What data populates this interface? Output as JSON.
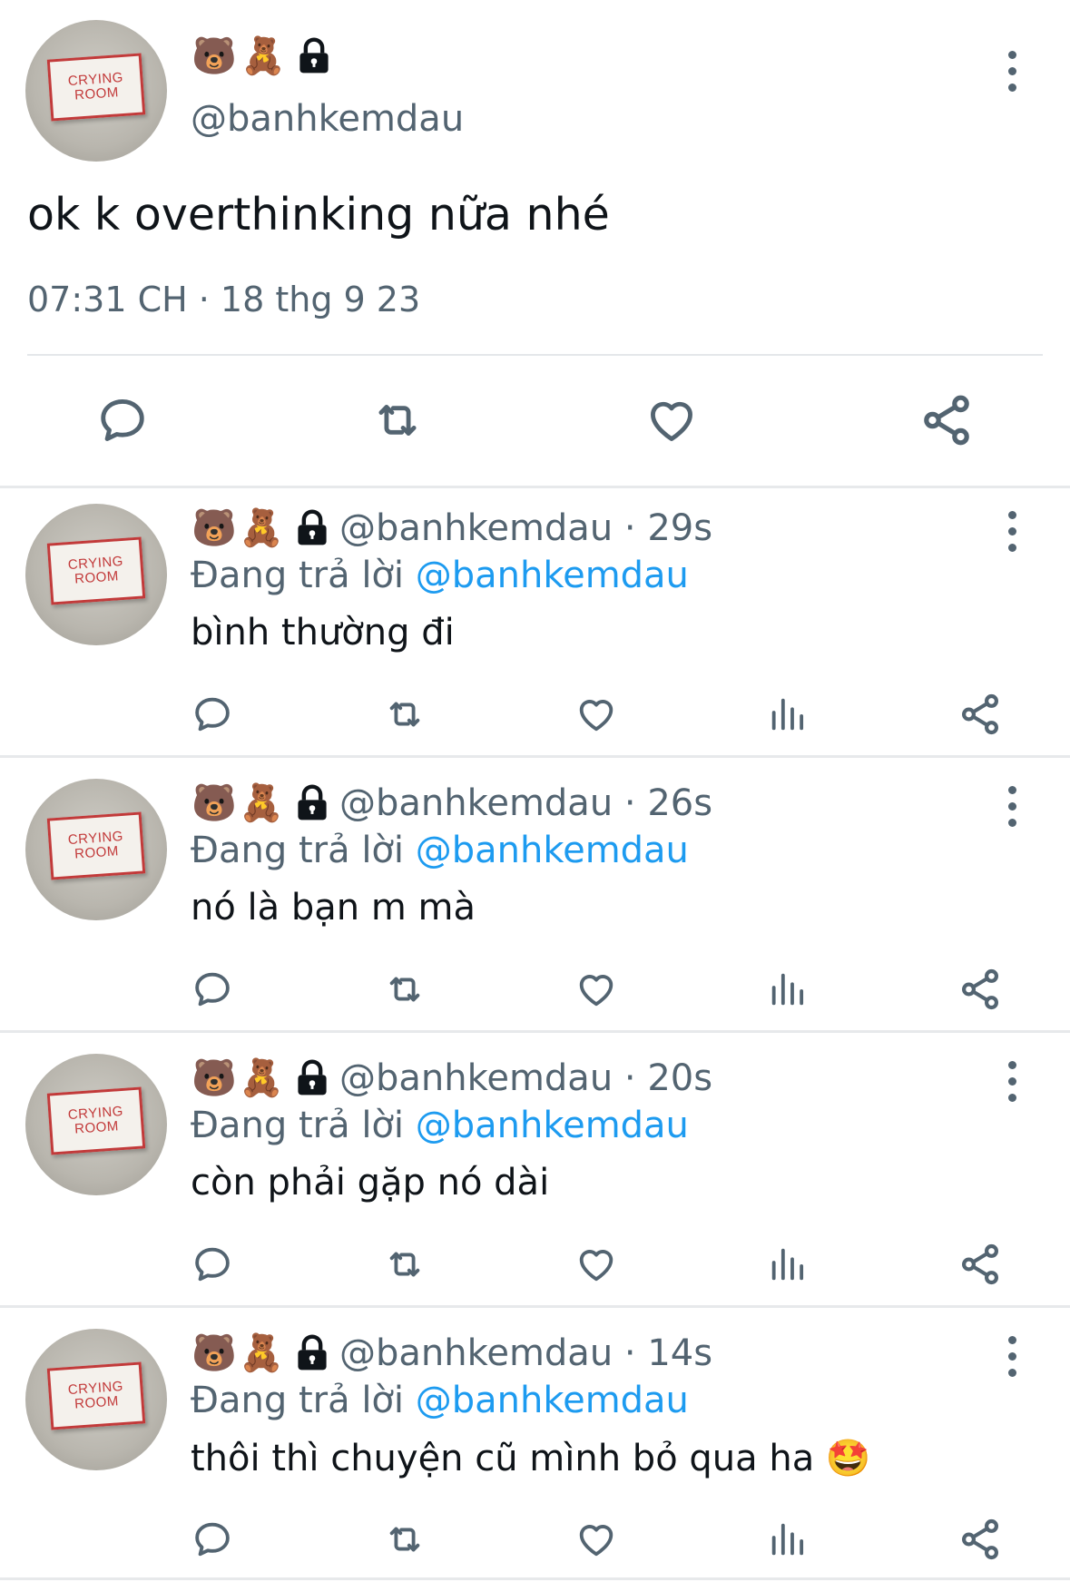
{
  "main_tweet": {
    "name_emojis": [
      "🐻",
      "🧸"
    ],
    "handle": "@banhkemdau",
    "avatar_text": [
      "CRYING",
      "ROOM"
    ],
    "text": "ok k overthinking nữa nhé",
    "timestamp": "07:31 CH · 18 thg 9 23",
    "actions": [
      "reply-icon",
      "retweet-icon",
      "like-icon",
      "share-icon"
    ]
  },
  "replies": [
    {
      "handle_time": "@banhkemdau · 29s",
      "replying_prefix": "Đang trả lời ",
      "replying_to": "@banhkemdau",
      "text": "bình thường đi"
    },
    {
      "handle_time": "@banhkemdau · 26s",
      "replying_prefix": "Đang trả lời ",
      "replying_to": "@banhkemdau",
      "text": "nó là bạn m mà"
    },
    {
      "handle_time": "@banhkemdau · 20s",
      "replying_prefix": "Đang trả lời ",
      "replying_to": "@banhkemdau",
      "text": "còn phải gặp nó dài"
    },
    {
      "handle_time": "@banhkemdau · 14s",
      "replying_prefix": "Đang trả lời ",
      "replying_to": "@banhkemdau",
      "text": "thôi thì chuyện cũ mình bỏ qua ha 🤩"
    }
  ],
  "reply_actions": [
    "reply-icon",
    "retweet-icon",
    "like-icon",
    "views-icon",
    "share-icon"
  ],
  "colors": {
    "text": "#0f1419",
    "secondary": "#536471",
    "link": "#1d9bf0",
    "divider": "#e7e9eb"
  }
}
